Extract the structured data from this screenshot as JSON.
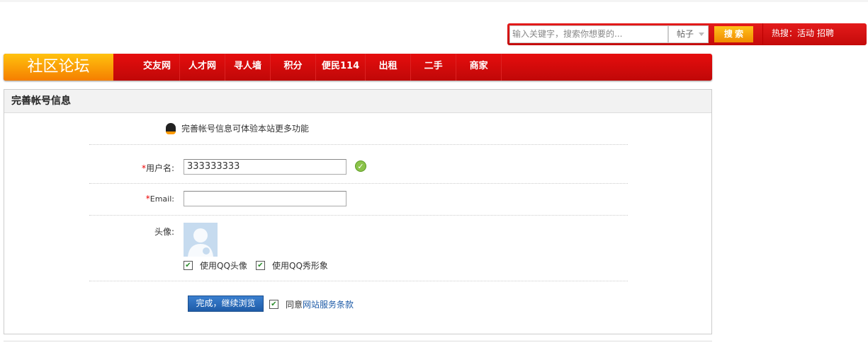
{
  "search": {
    "placeholder": "输入关键字，搜索你想要的...",
    "category": "帖子",
    "button": "搜 索",
    "hot_label": "热搜：",
    "hot_items": [
      "活动",
      "招聘"
    ]
  },
  "nav": {
    "logo": "社区论坛",
    "items": [
      "交友网",
      "人才网",
      "寻人墙",
      "积分",
      "便民114",
      "出租",
      "二手",
      "商家"
    ]
  },
  "panel": {
    "title": "完善帐号信息",
    "tip": "完善帐号信息可体验本站更多功能",
    "username_label": "用户名:",
    "username_value": "333333333",
    "email_label": "Email:",
    "email_value": "",
    "avatar_label": "头像:",
    "use_qq_avatar": "使用QQ头像",
    "use_qq_show": "使用QQ秀形象",
    "submit": "完成，继续浏览",
    "agree_prefix": "同意",
    "agree_link": "网站服务条款",
    "required_mark": "*"
  }
}
